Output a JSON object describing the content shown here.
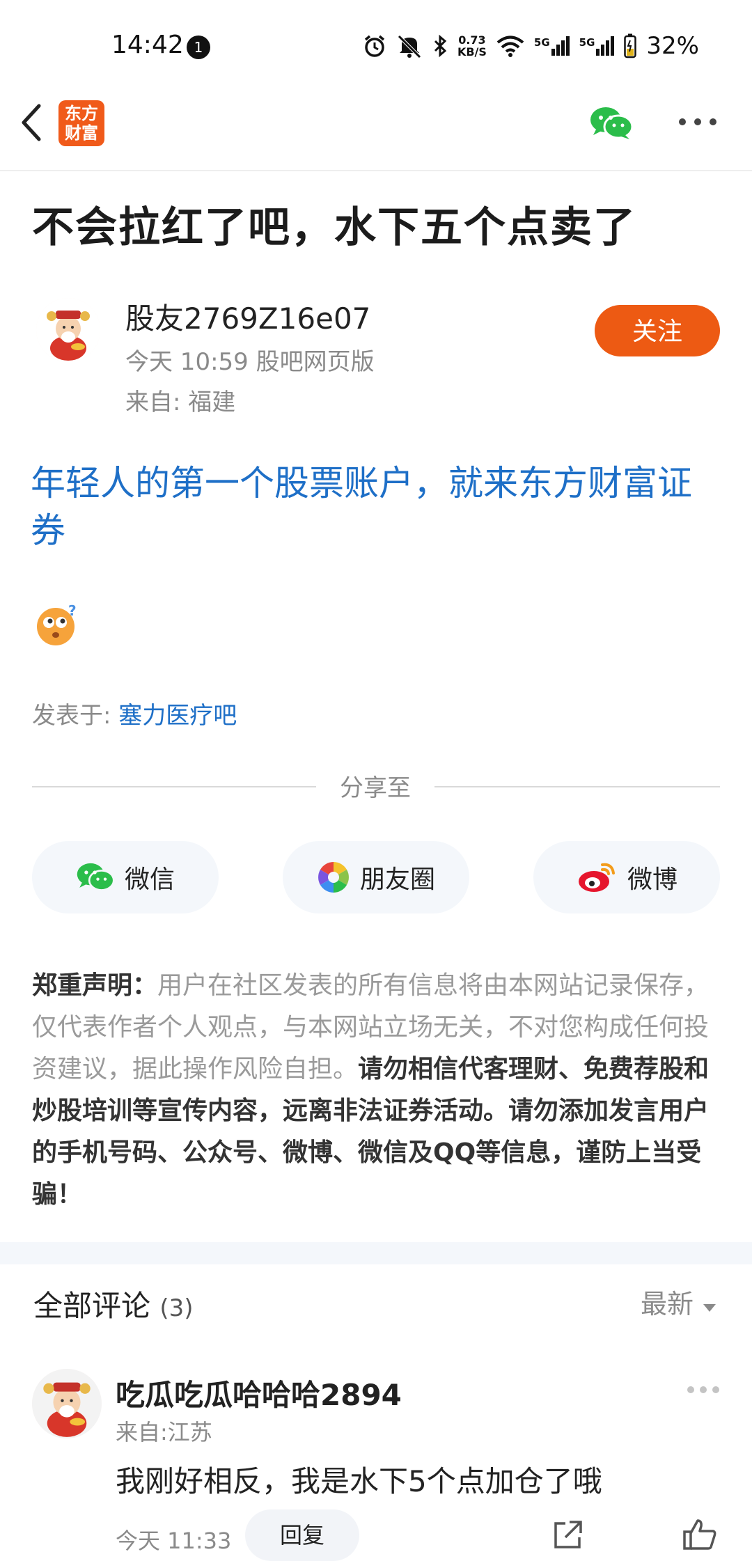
{
  "status_bar": {
    "time": "14:42",
    "notification_count": "1",
    "net_speed_top": "0.73",
    "net_speed_unit": "KB/S",
    "signal1": "5G",
    "signal2": "5G",
    "battery": "32%"
  },
  "nav": {
    "logo_line1": "东方",
    "logo_line2": "财富"
  },
  "post": {
    "title": "不会拉红了吧，水下五个点卖了",
    "author": "股友2769Z16e07",
    "time_source": "今天 10:59 股吧网页版",
    "location": "来自: 福建",
    "follow_label": "关注",
    "ad_link": "年轻人的第一个股票账户，就来东方财富证券",
    "posted_in_label": "发表于: ",
    "posted_in_bar": "塞力医疗吧"
  },
  "share": {
    "label": "分享至",
    "wechat": "微信",
    "moments": "朋友圈",
    "weibo": "微博"
  },
  "disclaimer": {
    "heading": "郑重声明",
    "colon": "：",
    "normal": "用户在社区发表的所有信息将由本网站记录保存，仅代表作者个人观点，与本网站立场无关，不对您构成任何投资建议，据此操作风险自担。",
    "bold": "请勿相信代客理财、免费荐股和炒股培训等宣传内容，远离非法证券活动。请勿添加发言用户的手机号码、公众号、微博、微信及QQ等信息，谨防上当受骗！"
  },
  "comments": {
    "title": "全部评论",
    "count": "(3)",
    "sort": "最新",
    "items": [
      {
        "name": "吃瓜吃瓜哈哈哈2894",
        "location": "来自:江苏",
        "text": "我刚好相反，我是水下5个点加仓了哦",
        "time": "今天 11:33",
        "reply_label": "回复"
      }
    ]
  },
  "colors": {
    "brand_orange": "#ed5a13",
    "link_blue": "#1e6fc7",
    "wechat_green": "#2bbd4a",
    "weibo_red": "#e6162d"
  },
  "icons": [
    "back-arrow-icon",
    "wechat-icon",
    "more-icon",
    "moments-icon",
    "weibo-icon",
    "share-icon",
    "like-icon",
    "avatar-icon",
    "emoji-icon"
  ]
}
